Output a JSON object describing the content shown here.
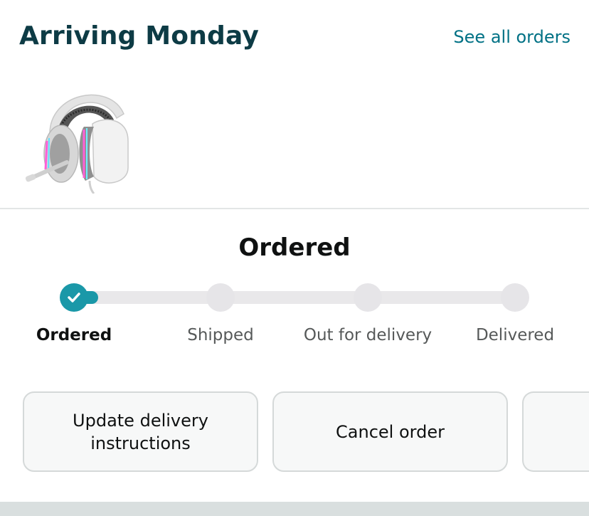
{
  "header": {
    "title": "Arriving Monday",
    "see_all_link": "See all orders"
  },
  "product": {
    "icon": "headset-image"
  },
  "tracking": {
    "status_title": "Ordered",
    "progress": 0.05,
    "accent_color": "#1a98a8",
    "steps": [
      {
        "label": "Ordered",
        "completed": true
      },
      {
        "label": "Shipped",
        "completed": false
      },
      {
        "label": "Out for delivery",
        "completed": false
      },
      {
        "label": "Delivered",
        "completed": false
      }
    ]
  },
  "actions": {
    "update_delivery": "Update delivery instructions",
    "cancel_order": "Cancel order"
  }
}
